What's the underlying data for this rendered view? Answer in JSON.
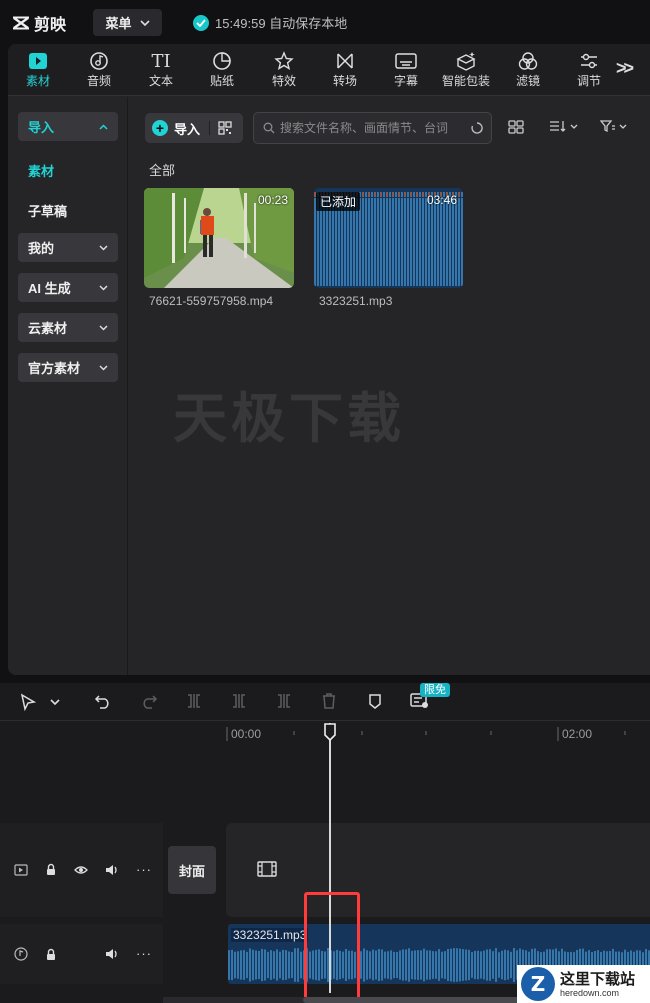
{
  "app": {
    "name": "剪映"
  },
  "titlebar": {
    "menu_label": "菜单",
    "save_status": "15:49:59 自动保存本地"
  },
  "toolbar": {
    "tools": [
      {
        "label": "素材",
        "icon": "media-icon",
        "active": true
      },
      {
        "label": "音频",
        "icon": "audio-icon"
      },
      {
        "label": "文本",
        "icon": "text-icon"
      },
      {
        "label": "贴纸",
        "icon": "sticker-icon"
      },
      {
        "label": "特效",
        "icon": "effects-icon"
      },
      {
        "label": "转场",
        "icon": "transition-icon"
      },
      {
        "label": "字幕",
        "icon": "subtitle-icon"
      },
      {
        "label": "智能包装",
        "icon": "smart-pack-icon"
      },
      {
        "label": "滤镜",
        "icon": "filter-icon"
      },
      {
        "label": "调节",
        "icon": "adjust-icon"
      }
    ],
    "more_label": ">>"
  },
  "leftnav": {
    "import": "导入",
    "media": "素材",
    "draft": "子草稿",
    "mine": "我的",
    "ai": "AI 生成",
    "cloud": "云素材",
    "official": "官方素材"
  },
  "content": {
    "import_label": "导入",
    "search_placeholder": "搜索文件名称、画面情节、台词",
    "section_label": "全部",
    "items": [
      {
        "name": "76621-559757958.mp4",
        "duration": "00:23"
      },
      {
        "name": "3323251.mp3",
        "duration": "03:46",
        "badge": "已添加"
      }
    ],
    "watermark": "天极下载"
  },
  "timeline": {
    "free_badge": "限免",
    "ruler": [
      "00:00",
      "02:00"
    ],
    "cover_label": "封面",
    "audio_clip_name": "3323251.mp3"
  },
  "corner_logo": {
    "title": "这里下载站",
    "domain": "heredown.com",
    "letter": "Z"
  },
  "colors": {
    "accent": "#22d3d3",
    "audio_clip": "#16355a",
    "highlight": "#ff3b3b"
  }
}
